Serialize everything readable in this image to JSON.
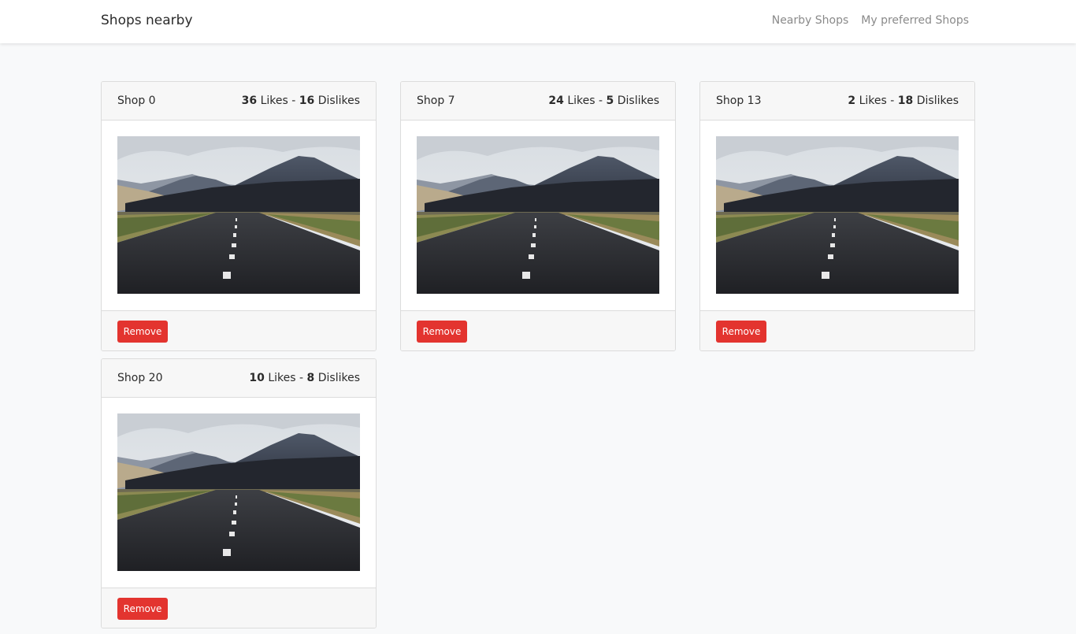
{
  "navbar": {
    "brand": "Shops nearby",
    "links": [
      {
        "label": "Nearby Shops"
      },
      {
        "label": "My preferred Shops"
      }
    ]
  },
  "shops": [
    {
      "name": "Shop 0",
      "likes": "36",
      "likes_label": "Likes",
      "separator": "-",
      "dislikes": "16",
      "dislikes_label": "Dislikes",
      "button": "Remove"
    },
    {
      "name": "Shop 7",
      "likes": "24",
      "likes_label": "Likes",
      "separator": "-",
      "dislikes": "5",
      "dislikes_label": "Dislikes",
      "button": "Remove"
    },
    {
      "name": "Shop 13",
      "likes": "2",
      "likes_label": "Likes",
      "separator": "-",
      "dislikes": "18",
      "dislikes_label": "Dislikes",
      "button": "Remove"
    },
    {
      "name": "Shop 20",
      "likes": "10",
      "likes_label": "Likes",
      "separator": "-",
      "dislikes": "8",
      "dislikes_label": "Dislikes",
      "button": "Remove"
    }
  ],
  "colors": {
    "remove_button": "#e3342f",
    "page_background": "#f8f9fa"
  }
}
